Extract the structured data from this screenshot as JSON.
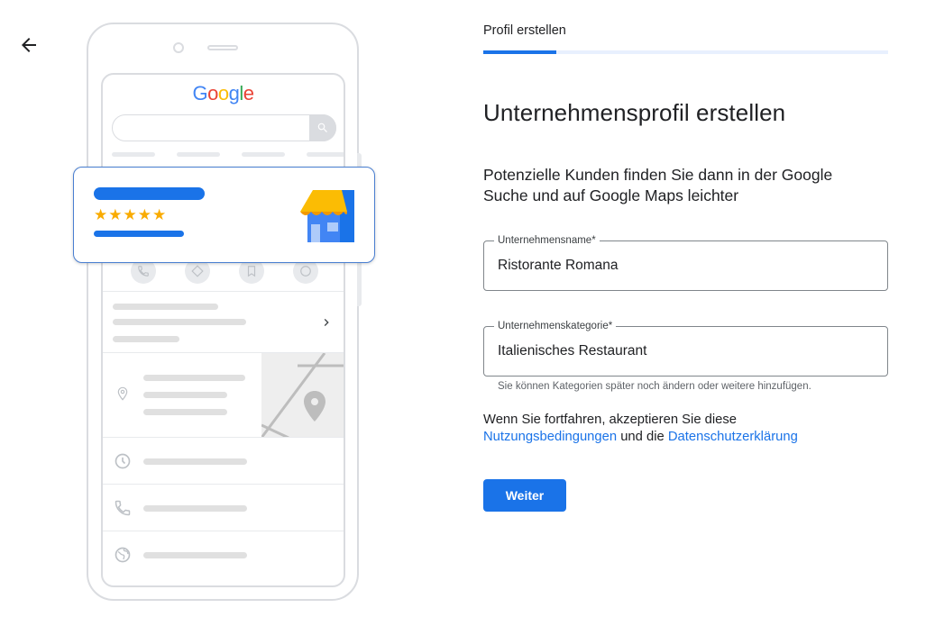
{
  "header": {
    "step_title": "Profil erstellen",
    "progress_fraction": 0.18
  },
  "main": {
    "title": "Unternehmensprofil erstellen",
    "intro": "Potenzielle Kunden finden Sie dann in der Google Suche und auf Google Maps leichter"
  },
  "form": {
    "business_name": {
      "label": "Unternehmensname*",
      "value": "Ristorante Romana"
    },
    "business_category": {
      "label": "Unternehmenskategorie*",
      "value": "Italienisches Restaurant",
      "helper": "Sie können Kategorien später noch ändern oder weitere hinzufügen."
    }
  },
  "terms": {
    "prefix": "Wenn Sie fortfahren, akzeptieren Sie diese",
    "terms_link": "Nutzungsbedingungen",
    "connector": " und die ",
    "privacy_link": "Datenschutzerklärung"
  },
  "actions": {
    "continue_label": "Weiter"
  },
  "illustration": {
    "logo": {
      "g1": "G",
      "o1": "o",
      "o2": "o",
      "g2": "g",
      "l": "l",
      "e": "e"
    },
    "stars": "★★★★★",
    "rating": 5,
    "colors": {
      "primary": "#1a73e8",
      "star": "#f9ab00",
      "store_awning": "#fbbc04",
      "store_body": "#4285f4"
    }
  }
}
